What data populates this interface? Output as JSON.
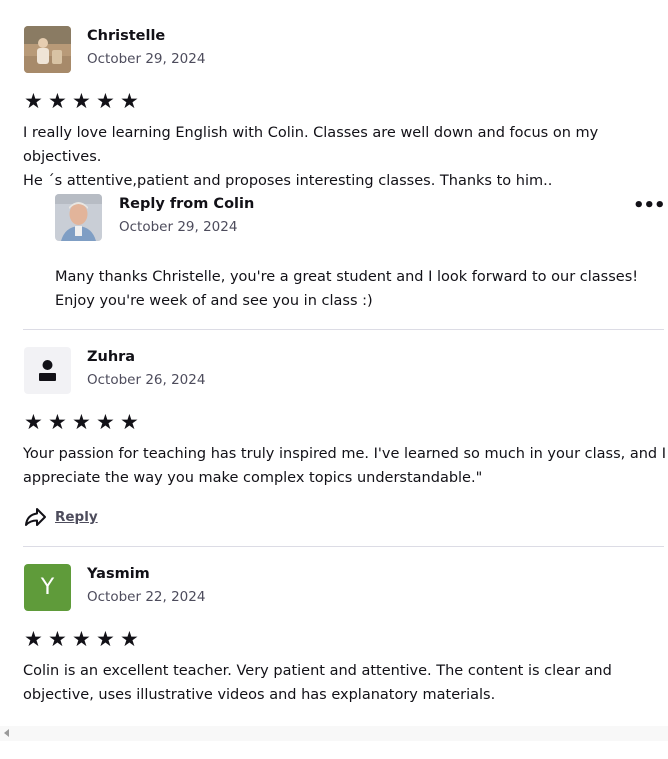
{
  "reviews": [
    {
      "name": "Christelle",
      "date": "October 29, 2024",
      "stars": "★★★★★",
      "text_line1": "I really love learning English with Colin. Classes are well down and focus on my objectives.",
      "text_line2": "He ´s attentive,patient and proposes interesting classes. Thanks to him..",
      "reply": {
        "name": "Reply from Colin",
        "date": "October 29, 2024",
        "more": "•••",
        "text_line1": "Many thanks Christelle, you're a great student and I look forward to our classes!",
        "text_line2": "Enjoy you're week of and see you in class :)"
      }
    },
    {
      "name": "Zuhra",
      "date": "October 26, 2024",
      "stars": "★★★★★",
      "text_line1": "Your passion for teaching has truly inspired me. I've learned so much in your class, and I",
      "text_line2": "appreciate the way you make complex topics understandable.\"",
      "reply_label": "Reply"
    },
    {
      "name": "Yasmim",
      "initial": "Y",
      "date": "October 22, 2024",
      "stars": "★★★★★",
      "text_line1": "Colin is an excellent teacher. Very patient and attentive. The content is clear and",
      "text_line2": "objective, uses illustrative videos and has explanatory materials."
    }
  ],
  "colors": {
    "avatar_green": "#5f9b3a",
    "avatar_placeholder_bg": "#f2f2f5",
    "divider": "#dcdce5"
  }
}
